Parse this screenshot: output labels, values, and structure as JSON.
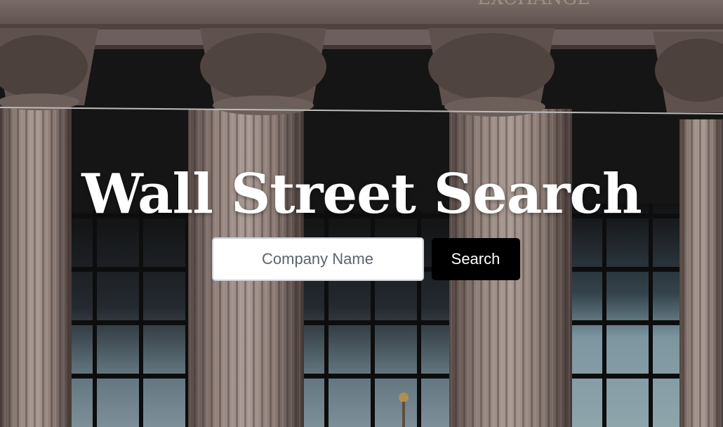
{
  "hero": {
    "background_image": "wall-street-columns-photo",
    "title": "Wall Street Search"
  },
  "search": {
    "placeholder": "Company Name",
    "value": "",
    "button_label": "Search"
  },
  "colors": {
    "title_text": "#ffffff",
    "button_bg": "#000000",
    "button_text": "#ffffff",
    "input_border": "#cfd3d8",
    "stone": "#9c8a82"
  }
}
